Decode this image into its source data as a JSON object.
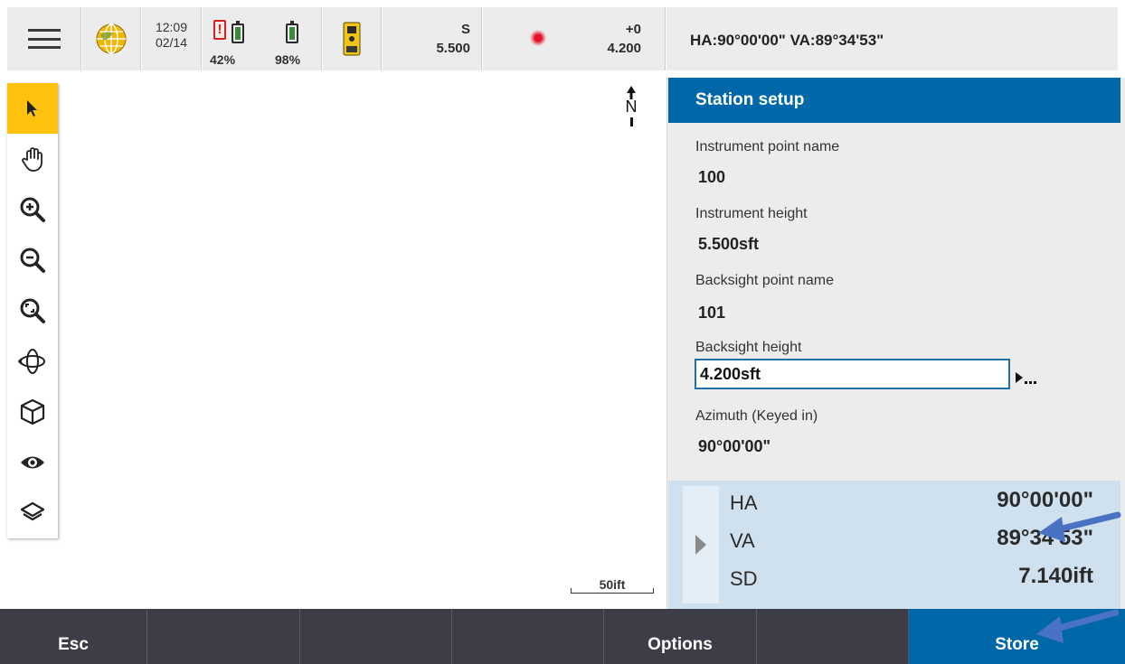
{
  "status_bar": {
    "menu_icon": "hamburger-menu-icon",
    "globe_icon": "globe-icon",
    "time": "12:09",
    "date": "02/14",
    "battery_internal_warning": "!",
    "battery_internal_pct": "42%",
    "battery_instrument_pct": "98%",
    "instrument_icon": "total-station-icon",
    "target_label": "S",
    "target_height": "5.500",
    "laser_icon": "laser-pointer-icon",
    "prism_constant": "+0",
    "prism_height": "4.200",
    "ha_va_readout": "HA:90°00'00\"  VA:89°34'53\""
  },
  "map": {
    "tools": [
      {
        "name": "select-arrow-icon"
      },
      {
        "name": "pan-hand-icon"
      },
      {
        "name": "zoom-in-icon"
      },
      {
        "name": "zoom-out-icon"
      },
      {
        "name": "zoom-extents-icon"
      },
      {
        "name": "orbit-icon"
      },
      {
        "name": "3d-view-cube-icon"
      },
      {
        "name": "visibility-eye-icon"
      },
      {
        "name": "layers-icon"
      }
    ],
    "north_label": "N",
    "scale_label": "50ift"
  },
  "panel": {
    "title": "Station setup",
    "fields": {
      "instrument_point_name_label": "Instrument point name",
      "instrument_point_name_value": "100",
      "instrument_height_label": "Instrument height",
      "instrument_height_value": "5.500sft",
      "backsight_point_name_label": "Backsight point name",
      "backsight_point_name_value": "101",
      "backsight_height_label": "Backsight height",
      "backsight_height_value": "4.200sft",
      "azimuth_label": "Azimuth (Keyed in)",
      "azimuth_value": "90°00'00\""
    },
    "observations": [
      {
        "key": "HA",
        "value": "90°00'00\""
      },
      {
        "key": "VA",
        "value": "89°34'53\""
      },
      {
        "key": "SD",
        "value": "7.140ift"
      }
    ]
  },
  "softkeys": {
    "esc": "Esc",
    "options": "Options",
    "store": "Store"
  },
  "colors": {
    "accent_blue": "#0068a8",
    "active_tool": "#ffc20e",
    "softkey_bar": "#3d3d47",
    "callout_arrow": "#4a72c4"
  }
}
